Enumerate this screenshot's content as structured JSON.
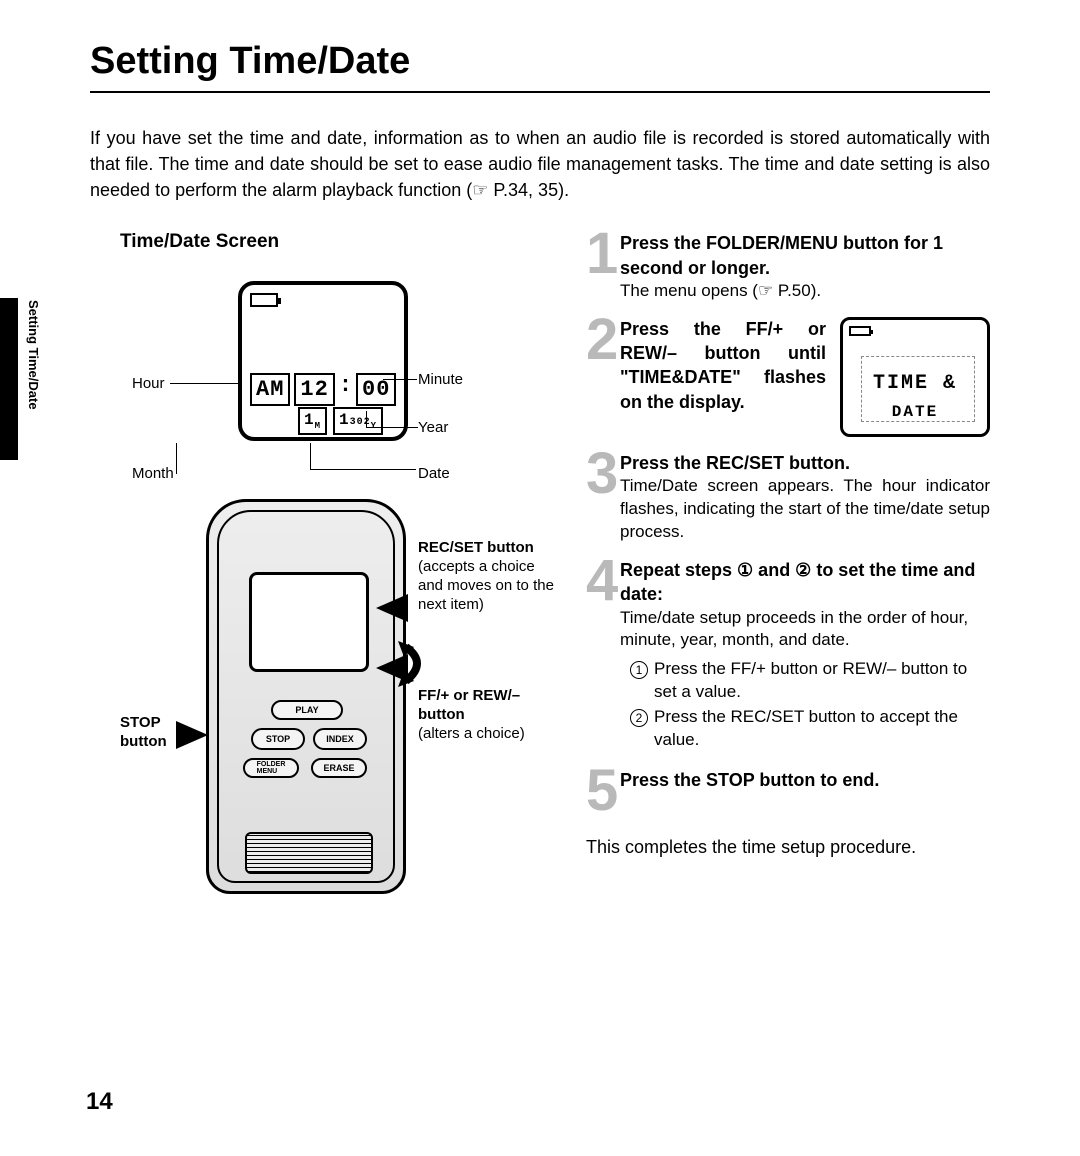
{
  "title": "Setting Time/Date",
  "intro": "If you have set the time and date, information as to when an audio file is recorded is stored automatically with that file. The time and date should be set to ease audio file management tasks. The time and date setting is also needed to perform the alarm playback function (☞ P.34, 35).",
  "left": {
    "screen_heading": "Time/Date Screen",
    "labels": {
      "hour": "Hour",
      "minute": "Minute",
      "month": "Month",
      "date": "Date",
      "year": "Year"
    },
    "lcd": {
      "ampm": "AM",
      "hour": "12",
      "sep": ":",
      "minute": "00",
      "month": "1",
      "month_suffix": "M",
      "day": "1",
      "year": "302",
      "year_suffix": "Y"
    },
    "device_buttons": {
      "play": "PLAY",
      "stop": "STOP",
      "index": "INDEX",
      "folder_menu": "FOLDER\nMENU",
      "erase": "ERASE"
    },
    "callouts": {
      "stop": "STOP button",
      "recset_title": "REC/SET button",
      "recset_desc": "(accepts a choice and moves on to the next item)",
      "ffrew_title": "FF/+ or REW/– button",
      "ffrew_desc": "(alters a choice)"
    }
  },
  "steps": {
    "s1_bold": "Press the FOLDER/MENU button for 1 second or longer.",
    "s1_sub": "The menu opens (☞ P.50).",
    "s2_bold": "Press the FF/+ or REW/– button until \"TIME&DATE\" flashes on the display.",
    "s2_lcd_line1": "TIME &",
    "s2_lcd_line2": "DATE",
    "s3_bold": "Press the REC/SET button.",
    "s3_sub": "Time/Date screen appears. The hour indicator flashes, indicating the start of the time/date setup process.",
    "s4_bold": "Repeat steps ① and ② to set the time and date:",
    "s4_sub": "Time/date setup proceeds in the order of hour, minute, year, month, and date.",
    "s4_i1": "Press the FF/+ button or REW/– button to set a value.",
    "s4_i2": "Press the REC/SET button to accept the value.",
    "s5_bold": "Press the STOP button to end."
  },
  "closing": "This completes the time setup procedure.",
  "side_text": "Setting Time/Date",
  "page_number": "14"
}
